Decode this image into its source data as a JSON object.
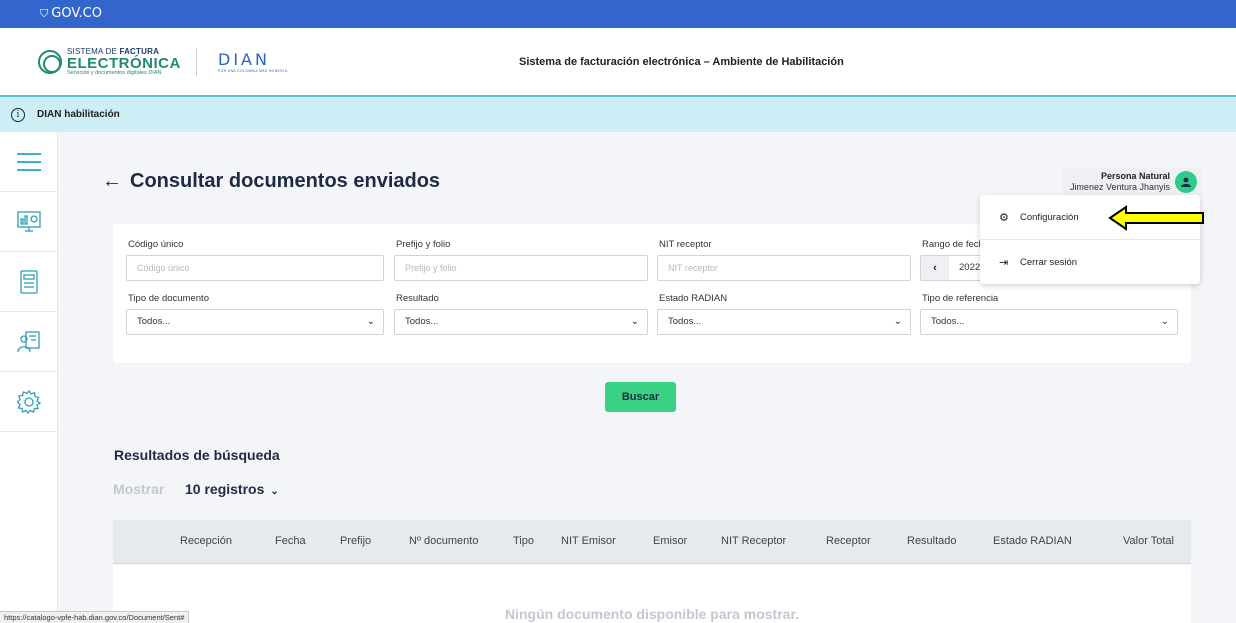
{
  "gov_bar": {
    "logo_text": "GOV.CO"
  },
  "header": {
    "brand_line1_prefix": "SISTEMA DE ",
    "brand_line1_bold": "FACTURA",
    "brand_line2": "ELECTRÓNICA",
    "brand_line3": "Servicios y documentos digitales DIAN",
    "dian_logo": "DIAN",
    "dian_tagline": "POR UNA COLOMBIA MÁS HONESTA",
    "title": "Sistema de facturación electrónica – Ambiente de Habilitación"
  },
  "env_bar": {
    "label": "DIAN habilitación",
    "icon": "info-icon"
  },
  "sidebar": {
    "items": [
      {
        "name": "menu-icon"
      },
      {
        "name": "dashboard-icon"
      },
      {
        "name": "documents-icon"
      },
      {
        "name": "users-icon"
      },
      {
        "name": "settings-icon"
      }
    ]
  },
  "page": {
    "title": "Consultar documentos enviados"
  },
  "user": {
    "role": "Persona Natural",
    "name": "Jimenez Ventura Jhanyis"
  },
  "filters": {
    "codigo_label": "Código único",
    "codigo_placeholder": "Código único",
    "prefijo_label": "Prefijo y folio",
    "prefijo_placeholder": "Prefijo y folio",
    "nit_label": "NIT receptor",
    "nit_placeholder": "NIT receptor",
    "rango_label": "Rango de fech",
    "rango_value": "2022",
    "tipo_doc_label": "Tipo de documento",
    "tipo_doc_value": "Todos...",
    "resultado_label": "Resultado",
    "resultado_value": "Todos...",
    "radian_label": "Estado RADIAN",
    "radian_value": "Todos...",
    "tipo_ref_label": "Tipo de referencia",
    "tipo_ref_value": "Todos..."
  },
  "search_button": "Buscar",
  "results": {
    "title": "Resultados de búsqueda",
    "show_label": "Mostrar",
    "show_value": "10 registros",
    "columns": [
      "Recepción",
      "Fecha",
      "Prefijo",
      "Nº documento",
      "Tipo",
      "NIT Emisor",
      "Emisor",
      "NIT Receptor",
      "Receptor",
      "Resultado",
      "Estado RADIAN",
      "Valor Total"
    ],
    "empty_message": "Ningún documento disponible para mostrar."
  },
  "user_menu": {
    "items": [
      {
        "label": "Configuración",
        "icon": "gear-icon"
      },
      {
        "label": "Cerrar sesión",
        "icon": "sign-out-icon"
      }
    ]
  },
  "status_url": "https://catalogo-vpfe-hab.dian.gov.co/Document/Sent#",
  "colors": {
    "gov_blue": "#3366cc",
    "accent_green": "#3ad185",
    "env_bar": "#cdeef5",
    "annotation": "#ffff00"
  }
}
